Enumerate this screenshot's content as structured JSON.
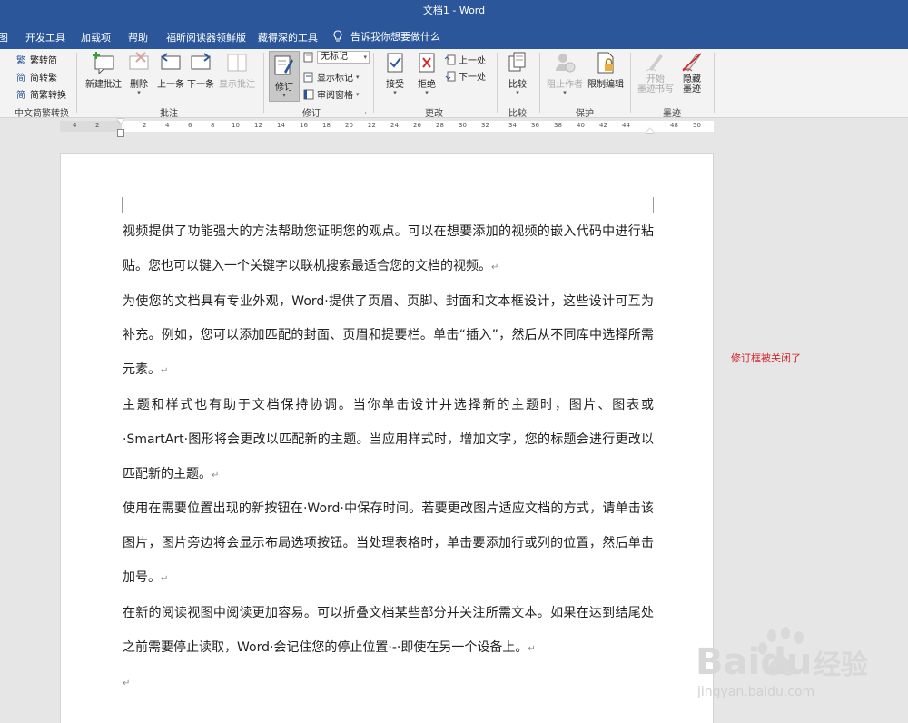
{
  "window": {
    "title": "文档1  -  Word"
  },
  "tabs": [
    "图",
    "开发工具",
    "加载项",
    "帮助",
    "福昕阅读器领鲜版",
    "藏得深的工具"
  ],
  "tell_me": "告诉我你想要做什么",
  "ribbon": {
    "chinese_conversion": {
      "label": "中文简繁转换",
      "items": [
        "繁转简",
        "简转繁",
        "简繁转换"
      ]
    },
    "comments": {
      "label": "批注",
      "new_comment": "新建批注",
      "delete": "删除",
      "previous": "上一条",
      "next": "下一条",
      "show_comments": "显示批注"
    },
    "tracking": {
      "label": "修订",
      "track_changes": "修订",
      "markup_dropdown": "无标记",
      "show_markup": "显示标记",
      "reviewing_pane": "审阅窗格"
    },
    "changes": {
      "label": "更改",
      "accept": "接受",
      "reject": "拒绝",
      "previous": "上一处",
      "next": "下一处"
    },
    "compare": {
      "label": "比较",
      "compare": "比较"
    },
    "protect": {
      "label": "保护",
      "block_authors": "阻止作者",
      "restrict_editing": "限制编辑"
    },
    "ink": {
      "label": "墨迹",
      "start_inking": "开始\n墨迹书写",
      "start_inking_l1": "开始",
      "start_inking_l2": "墨迹书写",
      "hide_ink_l1": "隐藏",
      "hide_ink_l2": "墨迹"
    }
  },
  "ruler": {
    "ticks": [
      "4",
      "2",
      "2",
      "4",
      "6",
      "8",
      "10",
      "12",
      "14",
      "16",
      "18",
      "20",
      "22",
      "24",
      "26",
      "28",
      "30",
      "32",
      "34",
      "36",
      "38",
      "40",
      "42",
      "44",
      "48",
      "50"
    ]
  },
  "document": {
    "paragraphs": [
      "视频提供了功能强大的方法帮助您证明您的观点。可以在想要添加的视频的嵌入代码中进行粘贴。您也可以键入一个关键字以联机搜索最适合您的文档的视频。",
      "为使您的文档具有专业外观，Word·提供了页眉、页脚、封面和文本框设计，这些设计可互为补充。例如，您可以添加匹配的封面、页眉和提要栏。单击“插入”，然后从不同库中选择所需元素。",
      "主题和样式也有助于文档保持协调。当你单击设计并选择新的主题时，图片、图表或·SmartArt·图形将会更改以匹配新的主题。当应用样式时，增加文字，您的标题会进行更改以匹配新的主题。",
      "使用在需要位置出现的新按钮在·Word·中保存时间。若要更改图片适应文档的方式，请单击该图片，图片旁边将会显示布局选项按钮。当处理表格时，单击要添加行或列的位置，然后单击加号。",
      "在新的阅读视图中阅读更加容易。可以折叠文档某些部分并关注所需文本。如果在达到结尾处之前需要停止读取，Word·会记住您的停止位置·-·即使在另一个设备上。"
    ],
    "paragraph_mark": "↵"
  },
  "annotation": "修订框被关闭了",
  "watermark": {
    "brand": "Baidu",
    "cn": "经验",
    "url": "jingyan.baidu.com"
  }
}
